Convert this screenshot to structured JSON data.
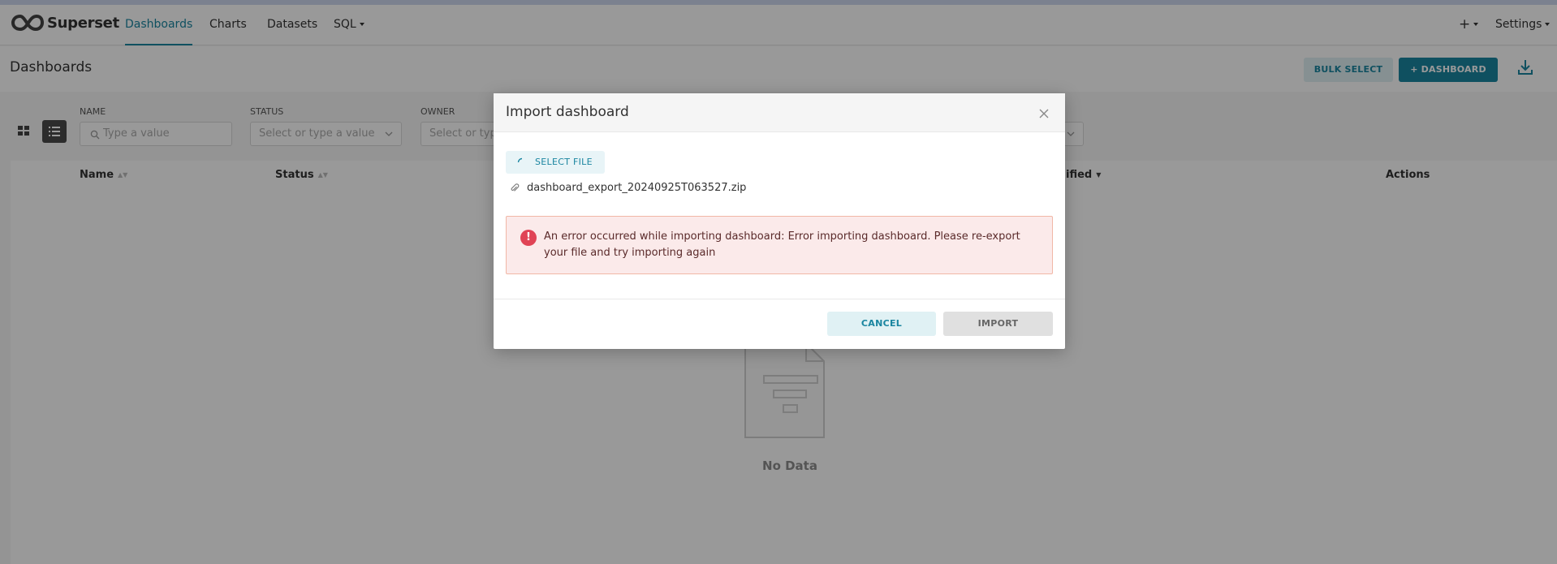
{
  "app": {
    "name": "Superset"
  },
  "nav": {
    "items": [
      {
        "label": "Dashboards",
        "active": true
      },
      {
        "label": "Charts"
      },
      {
        "label": "Datasets"
      },
      {
        "label": "SQL"
      }
    ],
    "right": {
      "plus_label": "+",
      "settings_label": "Settings"
    }
  },
  "header": {
    "title": "Dashboards",
    "bulk_select_label": "BULK SELECT",
    "add_dashboard_label": "+ DASHBOARD"
  },
  "filters": [
    {
      "label": "NAME",
      "placeholder": "Type a value"
    },
    {
      "label": "STATUS",
      "placeholder": "Select or type a value"
    },
    {
      "label": "OWNER",
      "placeholder": "Select or typ"
    }
  ],
  "table": {
    "columns": [
      "Name",
      "Status",
      "ified",
      "Actions"
    ],
    "empty_text": "No Data"
  },
  "modal": {
    "title": "Import dashboard",
    "select_file_label": "SELECT FILE",
    "file_name": "dashboard_export_20240925T063527.zip",
    "error_message": "An error occurred while importing dashboard: Error importing dashboard. Please re-export your file and try importing again",
    "cancel_label": "CANCEL",
    "import_label": "IMPORT"
  },
  "colors": {
    "accent": "#1a85a0",
    "error": "#e04355",
    "error_bg": "#fbeaea",
    "overlay": "rgba(0,0,0,0.40)"
  },
  "icons": [
    "superset-logo-icon",
    "grid-view-icon",
    "list-view-icon",
    "search-icon",
    "chevron-down-icon",
    "download-icon",
    "close-icon",
    "loading-spinner-icon",
    "paperclip-icon",
    "error-icon",
    "empty-document-icon"
  ]
}
